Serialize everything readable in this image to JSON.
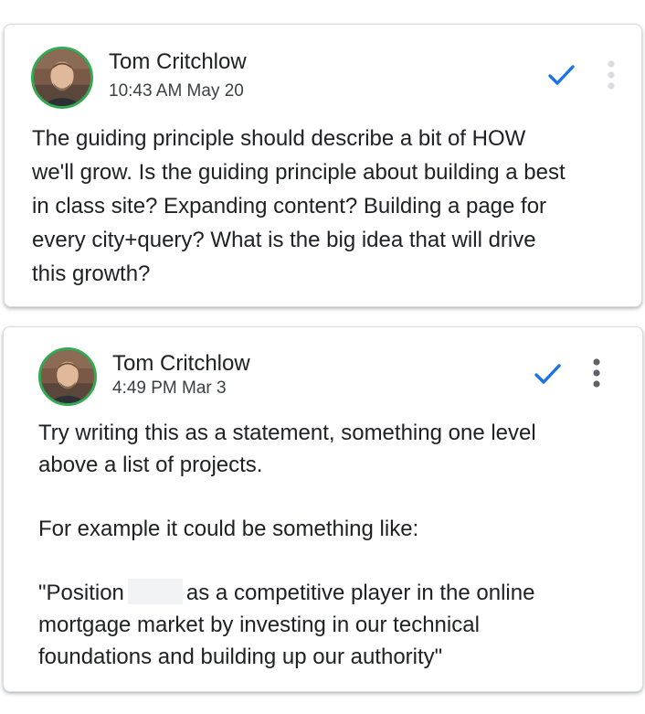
{
  "comments": [
    {
      "author": "Tom Critchlow",
      "timestamp": "10:43 AM May 20",
      "body_lines": [
        "The guiding principle should describe a bit of HOW",
        "we'll grow. Is the guiding principle about building a best",
        "in class site? Expanding content? Building a page for",
        "every city+query? What is the big idea that will drive",
        "this growth?"
      ]
    },
    {
      "author": "Tom Critchlow",
      "timestamp": "4:49 PM Mar 3",
      "body_lines": [
        "Try writing this as a statement, something one level",
        "above a list of projects.",
        "For example it could be something like:",
        "\"Position",
        "as a competitive player in the online",
        "mortgage market by investing in our technical",
        "foundations and building up our authority\""
      ]
    }
  ],
  "icons": {
    "resolve": "checkmark-icon",
    "more": "more-vertical-icon",
    "avatar": "user-avatar-photo"
  },
  "colors": {
    "accent_blue": "#1a73e8",
    "avatar_ring": "#34a853",
    "kebab_light": "#dadce0",
    "kebab_dark": "#5f6368",
    "redaction": "#f1f3f4"
  }
}
